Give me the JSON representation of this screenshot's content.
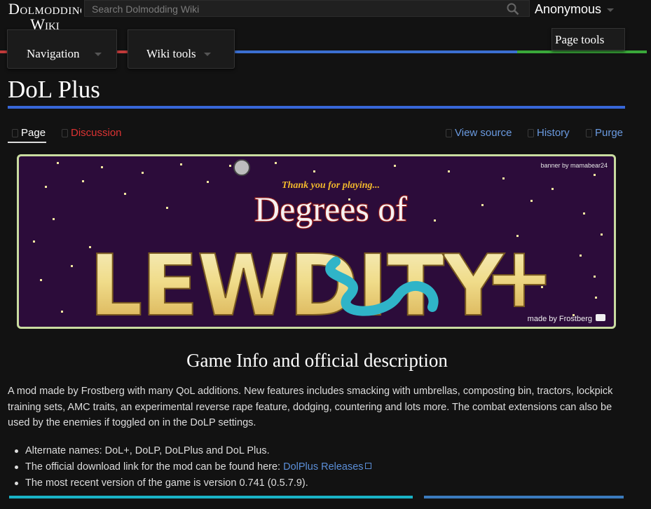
{
  "header": {
    "logo_line1": "Dolmodding",
    "logo_line2": "Wiki",
    "search_placeholder": "Search Dolmodding Wiki",
    "user_label": "Anonymous",
    "nav_label": "Navigation",
    "wikitools_label": "Wiki tools",
    "pagetools_label": "Page tools",
    "stripe_colors": [
      "#cc3333",
      "#cc3333",
      "#3366cc",
      "#3366cc",
      "#33aa33"
    ]
  },
  "page": {
    "title": "DoL Plus",
    "accent": "#3766d8"
  },
  "tabs": {
    "page": "Page",
    "discussion": "Discussion",
    "view_source": "View source",
    "history": "History",
    "purge": "Purge"
  },
  "banner": {
    "credit_top": "banner by mamabear24",
    "thanks": "Thank you for playing...",
    "line1": "Degrees of",
    "line2": "LEWDITY",
    "plus": "+",
    "credit_bottom": "made by Frostberg"
  },
  "content": {
    "section_heading": "Game Info and official description",
    "description": "A mod made by Frostberg with many QoL additions. New features includes smacking with umbrellas, composting bin, tractors, lockpick training sets, AMC traits, an experimental reverse rape feature, dodging, countering and lots more. The combat extensions can also be used by the enemies if toggled on in the DoLP settings.",
    "bullet1": "Alternate names: DoL+, DoLP, DoLPlus and DoL Plus.",
    "bullet2_text": "The official download link for the mod can be found here: ",
    "bullet2_link": "DolPlus Releases",
    "bullet3": "The most recent version of the game is version 0.741 (0.5.7.9)."
  }
}
